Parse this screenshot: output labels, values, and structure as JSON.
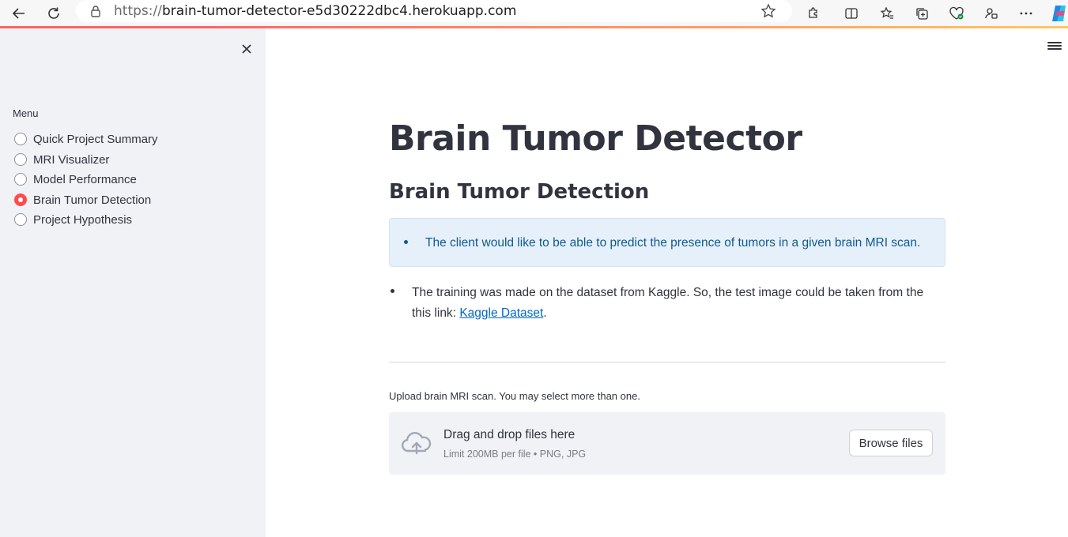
{
  "browser": {
    "url_protocol": "https://",
    "url_host": "brain-tumor-detector-e5d30222dbc4.herokuapp.com"
  },
  "sidebar": {
    "menu_label": "Menu",
    "items": [
      {
        "label": "Quick Project Summary",
        "selected": false
      },
      {
        "label": "MRI Visualizer",
        "selected": false
      },
      {
        "label": "Model Performance",
        "selected": false
      },
      {
        "label": "Brain Tumor Detection",
        "selected": true
      },
      {
        "label": "Project Hypothesis",
        "selected": false
      }
    ]
  },
  "main": {
    "title": "Brain Tumor Detector",
    "subtitle": "Brain Tumor Detection",
    "info_text": "The client would like to be able to predict the presence of tumors in a given brain MRI scan.",
    "body_text_before": "The training was made on the dataset from Kaggle. So, the test image could be taken from the this link: ",
    "body_link": "Kaggle Dataset",
    "body_text_after": ".",
    "upload_label": "Upload brain MRI scan. You may select more than one.",
    "dropzone_title": "Drag and drop files here",
    "dropzone_sub": "Limit 200MB per file • PNG, JPG",
    "browse_label": "Browse files"
  },
  "colors": {
    "accent": "#ff4b4b",
    "link": "#0068c9",
    "info_bg": "#e6f0fb",
    "info_text": "#0f5a8c",
    "sidebar_bg": "#f0f2f6"
  }
}
